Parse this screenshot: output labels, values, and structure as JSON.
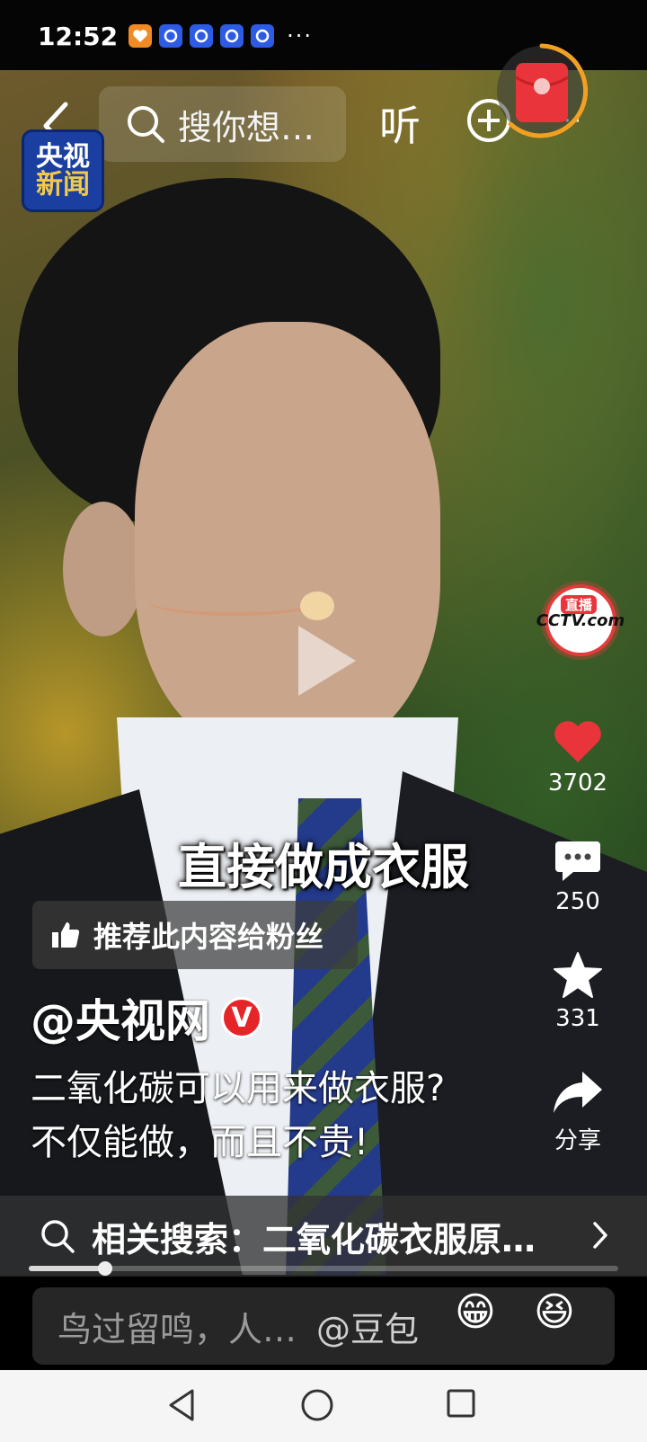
{
  "status_bar": {
    "time": "12:52",
    "more": "···"
  },
  "video": {
    "watermark_line1": "央视",
    "watermark_line2": "新闻",
    "caption": "直接做成衣服"
  },
  "top_nav": {
    "search_placeholder": "搜你想…",
    "listen_label": "听",
    "more": "···"
  },
  "side_panel": {
    "live_label": "直播",
    "avatar_logo": "CCTV.com",
    "likes": "3702",
    "comments": "250",
    "favorites": "331",
    "share_label": "分享"
  },
  "post": {
    "recommend_label": "推荐此内容给粉丝",
    "author": "@央视网",
    "verified_badge": "V",
    "desc_line1": "二氧化碳可以用来做衣服?",
    "desc_line2": "不仅能做，而且不贵!"
  },
  "related_search": {
    "text": "相关搜索：二氧化碳衣服原…"
  },
  "progress": {
    "fraction": 0.13
  },
  "comment_bar": {
    "placeholder": "鸟过留鸣，人…",
    "mention": "@豆包",
    "emoji1": "😁",
    "emoji2": "😆"
  },
  "colors": {
    "like": "#e8343a",
    "verified": "#e52528",
    "live_ring": "#e23b3b"
  },
  "icons": [
    "back-icon",
    "search-icon",
    "add-icon",
    "play-icon",
    "heart-icon",
    "comment-icon",
    "star-icon",
    "share-icon",
    "thumbs-up-icon",
    "chevron-right-icon",
    "nav-back-icon",
    "nav-home-icon",
    "nav-recents-icon"
  ]
}
